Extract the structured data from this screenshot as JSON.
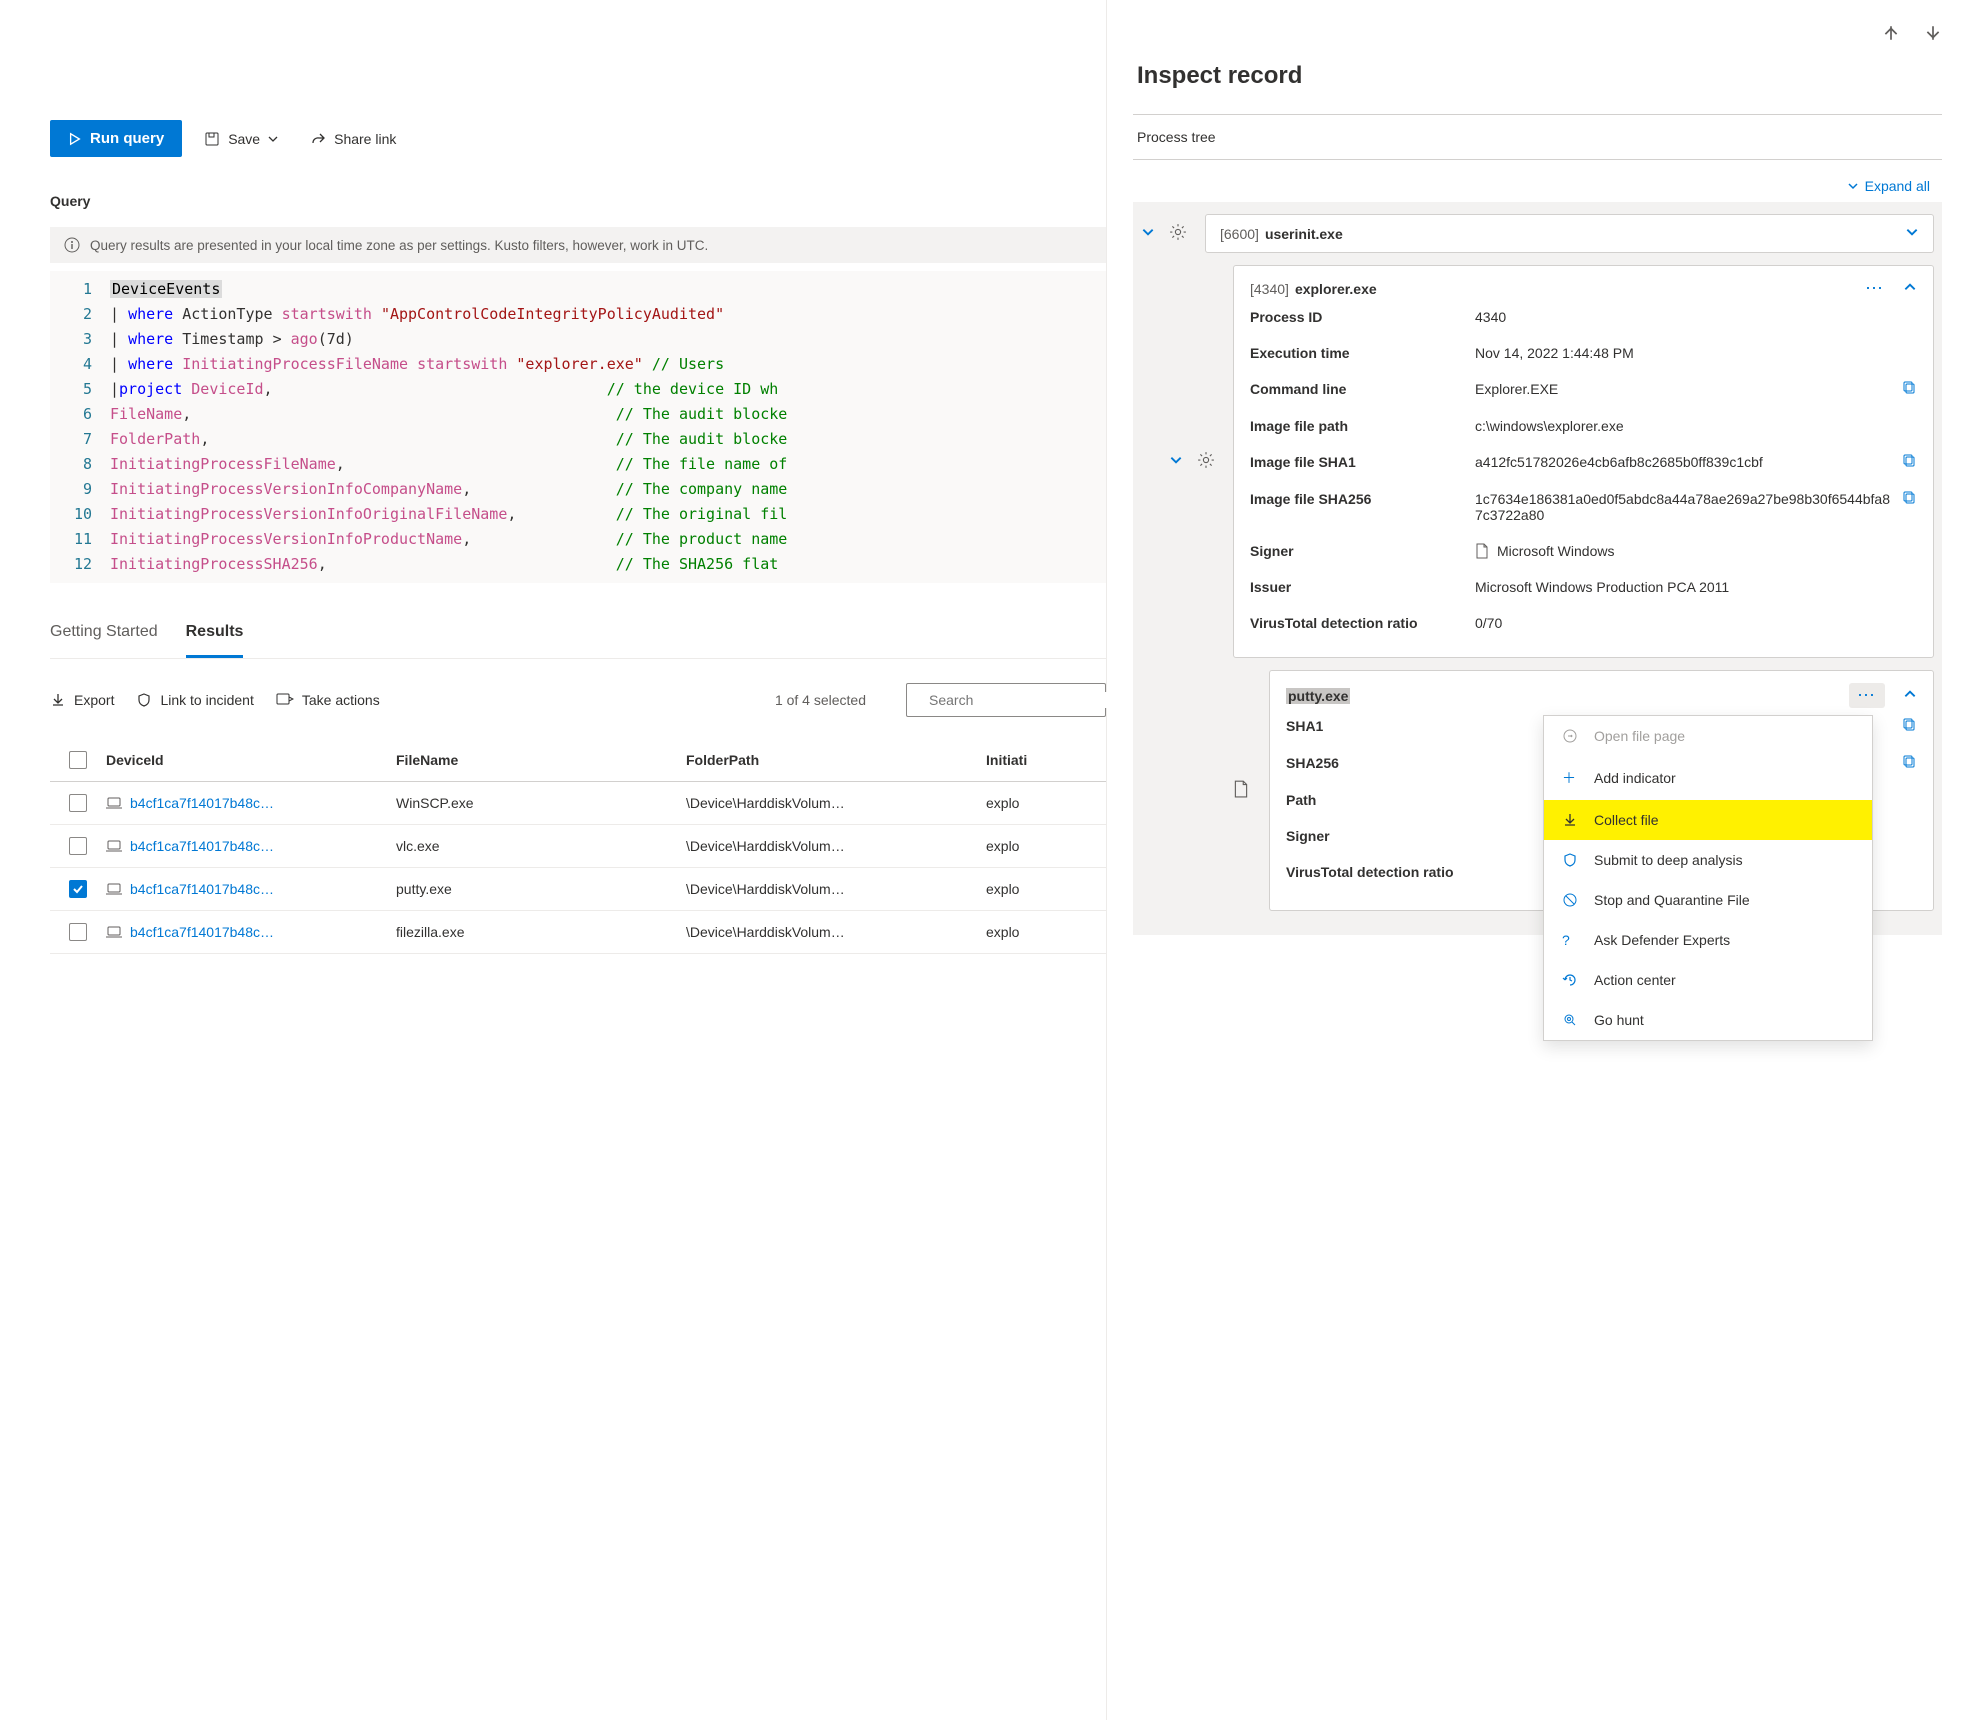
{
  "toolbar": {
    "run": "Run query",
    "save": "Save",
    "share": "Share link"
  },
  "query_label": "Query",
  "info_bar": "Query results are presented in your local time zone as per settings. Kusto filters, however, work in UTC.",
  "code": {
    "l1_table": "DeviceEvents",
    "l2_pipe": "|",
    "l2_kw": "where",
    "l2_field": "ActionType",
    "l2_fn": "startswith",
    "l2_str": "\"AppControlCodeIntegrityPolicyAudited\"",
    "l3_field": "Timestamp",
    "l3_op": ">",
    "l3_fn": "ago",
    "l3_arg": "(7d)",
    "l4_field": "InitiatingProcessFileName",
    "l4_str": "\"explorer.exe\"",
    "l4_com": "// Users",
    "l5_kw": "project",
    "l5_f": "DeviceId",
    "l5_com": "// the device ID wh",
    "l6_f": "FileName",
    "l6_com": "// The audit blocke",
    "l7_f": "FolderPath",
    "l7_com": "// The audit blocke",
    "l8_f": "InitiatingProcessFileName",
    "l8_com": "// The file name of",
    "l9_f": "InitiatingProcessVersionInfoCompanyName",
    "l9_com": "// The company name",
    "l10_f": "InitiatingProcessVersionInfoOriginalFileName",
    "l10_com": "// The original fil",
    "l11_f": "InitiatingProcessVersionInfoProductName",
    "l11_com": "// The product name",
    "l12_f": "InitiatingProcessSHA256",
    "l12_com": "// The SHA256 flat "
  },
  "tabs": {
    "t1": "Getting Started",
    "t2": "Results"
  },
  "actions": {
    "export": "Export",
    "link_incident": "Link to incident",
    "take_actions": "Take actions",
    "selected": "1 of 4 selected",
    "search_placeholder": "Search"
  },
  "grid": {
    "h_dev": "DeviceId",
    "h_fn": "FileName",
    "h_fp": "FolderPath",
    "h_ip": "Initiati",
    "rows": [
      {
        "dev": "b4cf1ca7f14017b48c…",
        "fn": "WinSCP.exe",
        "fp": "\\Device\\HarddiskVolum…",
        "ip": "explo"
      },
      {
        "dev": "b4cf1ca7f14017b48c…",
        "fn": "vlc.exe",
        "fp": "\\Device\\HarddiskVolum…",
        "ip": "explo"
      },
      {
        "dev": "b4cf1ca7f14017b48c…",
        "fn": "putty.exe",
        "fp": "\\Device\\HarddiskVolum…",
        "ip": "explo"
      },
      {
        "dev": "b4cf1ca7f14017b48c…",
        "fn": "filezilla.exe",
        "fp": "\\Device\\HarddiskVolum…",
        "ip": "explo"
      }
    ],
    "checked_index": 2
  },
  "panel": {
    "title": "Inspect record",
    "section": "Process tree",
    "expand_all": "Expand all",
    "node1": {
      "pid": "[6600]",
      "name": "userinit.exe"
    },
    "node2": {
      "pid": "[4340]",
      "name": "explorer.exe"
    },
    "node3": {
      "name": "putty.exe"
    },
    "details": {
      "pid_l": "Process ID",
      "pid_v": "4340",
      "et_l": "Execution time",
      "et_v": "Nov 14, 2022 1:44:48 PM",
      "cl_l": "Command line",
      "cl_v": "Explorer.EXE",
      "ifp_l": "Image file path",
      "ifp_v": "c:\\windows\\explorer.exe",
      "s1_l": "Image file SHA1",
      "s1_v": "a412fc51782026e4cb6afb8c2685b0ff839c1cbf",
      "s256_l": "Image file SHA256",
      "s256_v": "1c7634e186381a0ed0f5abdc8a44a78ae269a27be98b30f6544bfa87c3722a80",
      "sg_l": "Signer",
      "sg_v": "Microsoft Windows",
      "is_l": "Issuer",
      "is_v": "Microsoft Windows Production PCA 2011",
      "vt_l": "VirusTotal detection ratio",
      "vt_v": "0/70"
    },
    "putty": {
      "s1_l": "SHA1",
      "s256_l": "SHA256",
      "path_l": "Path",
      "sg_l": "Signer",
      "vt_l": "VirusTotal detection ratio"
    },
    "menu": {
      "open": "Open file page",
      "add": "Add indicator",
      "collect": "Collect file",
      "deep": "Submit to deep analysis",
      "stop": "Stop and Quarantine File",
      "ask": "Ask Defender Experts",
      "action": "Action center",
      "hunt": "Go hunt"
    }
  }
}
